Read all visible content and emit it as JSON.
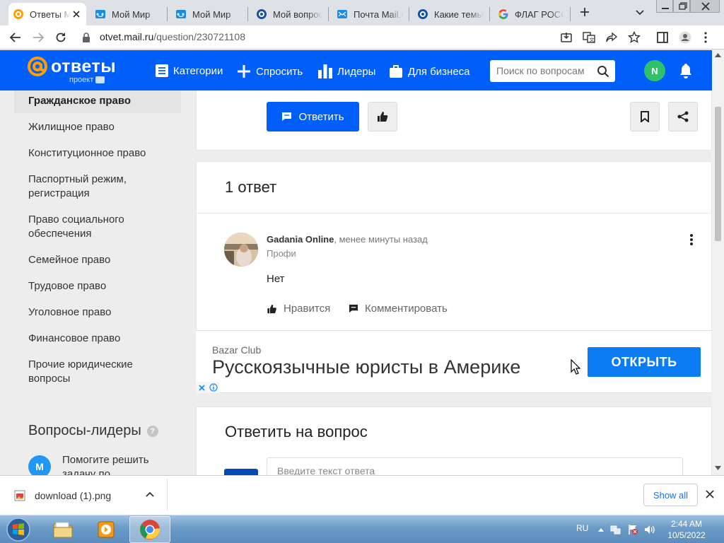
{
  "browser": {
    "tabs": [
      {
        "title": "Ответы Mail.ru",
        "icon": "otvety-icon",
        "active": true
      },
      {
        "title": "Мой Мир",
        "icon": "moimir-icon"
      },
      {
        "title": "Мой Мир",
        "icon": "moimir-icon"
      },
      {
        "title": "Мой вопрос",
        "icon": "otvety-icon"
      },
      {
        "title": "Почта Mail.ru",
        "icon": "mail-icon"
      },
      {
        "title": "Какие темы",
        "icon": "otvety-icon"
      },
      {
        "title": "ФЛАГ РОССИИ",
        "icon": "google-icon"
      }
    ],
    "url_host": "otvet.mail.ru",
    "url_path": "/question/230721108"
  },
  "header": {
    "logo_text": "ответы",
    "logo_sub": "проект",
    "nav": [
      {
        "label": "Категории",
        "icon": "list-icon"
      },
      {
        "label": "Спросить",
        "icon": "plus-icon"
      },
      {
        "label": "Лидеры",
        "icon": "bar-chart-icon"
      },
      {
        "label": "Для бизнеса",
        "icon": "briefcase-icon"
      }
    ],
    "search_placeholder": "Поиск по вопросам",
    "avatar_letter": "N"
  },
  "sidebar": {
    "categories": [
      "Гражданское право",
      "Жилищное право",
      "Конституционное право",
      "Паспортный режим, регистрация",
      "Право социального обеспечения",
      "Семейное право",
      "Трудовое право",
      "Уголовное право",
      "Финансовое право",
      "Прочие юридические вопросы"
    ],
    "leaders_title": "Вопросы-лидеры",
    "leader_item": {
      "avatar_letter": "M",
      "text": "Помогите решить задачу по"
    }
  },
  "question_actions": {
    "reply_label": "Ответить"
  },
  "answers": {
    "count_label": "1 ответ",
    "items": [
      {
        "author": "Gadania Online",
        "time": ", менее минуты назад",
        "rank": "Профи",
        "text": "Нет",
        "like_label": "Нравится",
        "comment_label": "Комментировать"
      }
    ]
  },
  "ad": {
    "brand": "Bazar Club",
    "title": "Русскоязычные юристы в Америке",
    "button": "ОТКРЫТЬ"
  },
  "reply_form": {
    "title": "Ответить на вопрос",
    "placeholder": "Введите текст ответа"
  },
  "download_bar": {
    "file_name": "download (1).png",
    "show_all": "Show all"
  },
  "taskbar": {
    "language": "RU",
    "time": "2:44 AM",
    "date": "10/5/2022"
  },
  "colors": {
    "brand_blue": "#005ff9",
    "ad_button": "#0b7cf2",
    "avatar_green": "#2fc26a"
  }
}
